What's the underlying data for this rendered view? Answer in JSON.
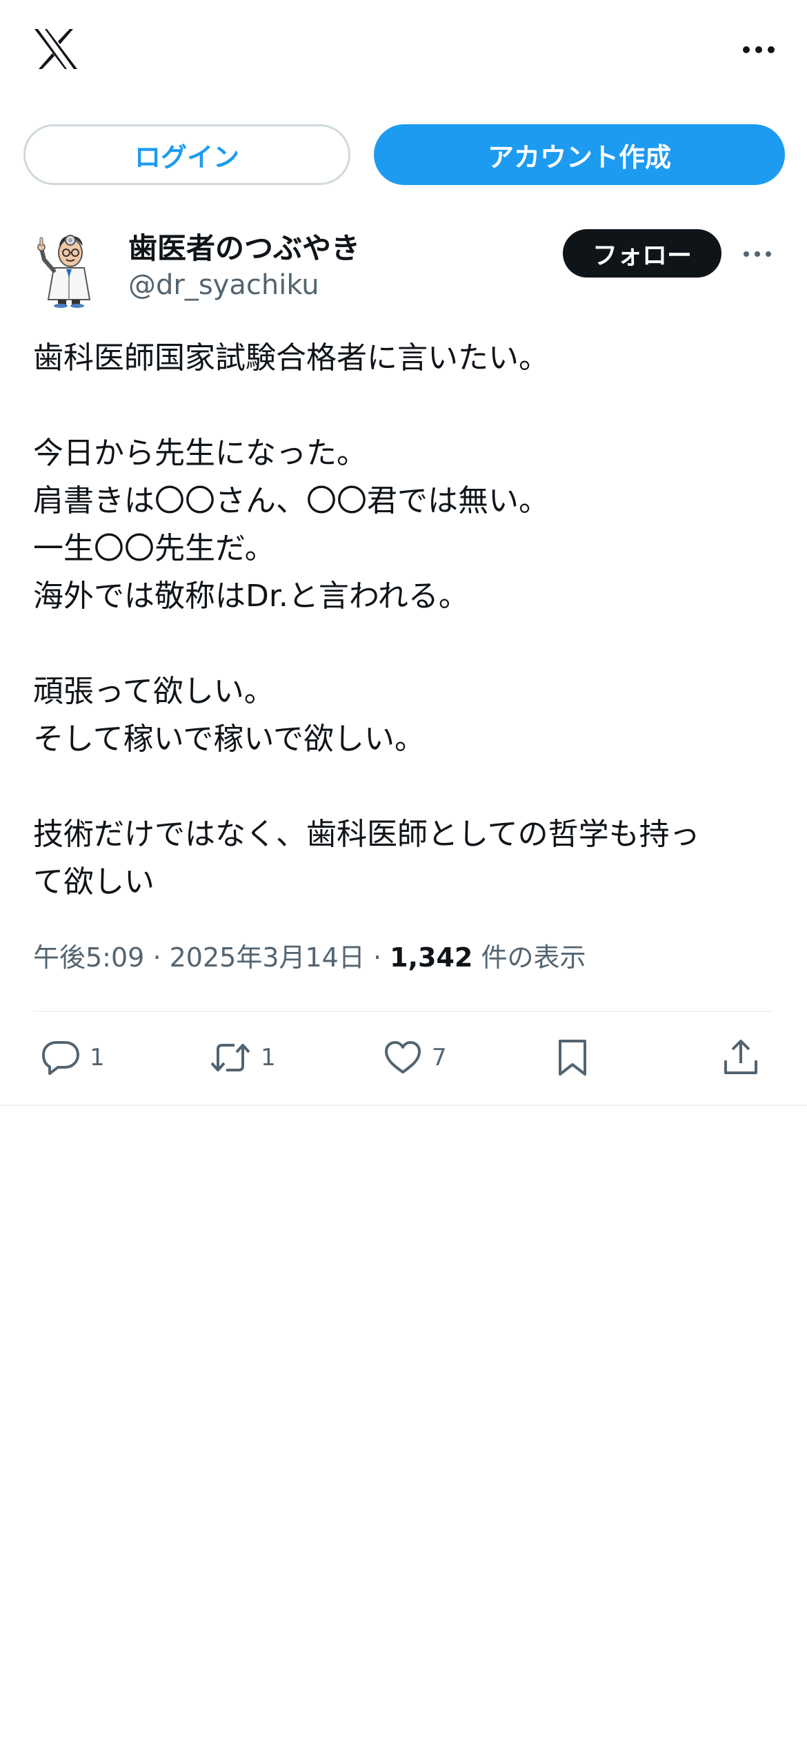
{
  "header": {
    "logo_icon": "x-logo-icon",
    "more_icon": "more-horizontal-icon"
  },
  "auth": {
    "login_label": "ログイン",
    "signup_label": "アカウント作成"
  },
  "post": {
    "author": {
      "display_name": "歯医者のつぶやき",
      "handle": "@dr_syachiku",
      "avatar_icon": "dentist-cartoon-avatar"
    },
    "follow_label": "フォロー",
    "more_icon": "more-horizontal-icon",
    "text_lines": [
      "歯科医師国家試験合格者に言いたい。",
      "",
      "今日から先生になった。",
      "肩書きは〇〇さん、〇〇君では無い。",
      "一生〇〇先生だ。",
      "海外では敬称はDr.と言われる。",
      "",
      "頑張って欲しい。",
      "そして稼いで稼いで欲しい。",
      "",
      "技術だけではなく、歯科医師としての哲学も持っ",
      "て欲しい"
    ],
    "time": "午後5:09",
    "separator": "·",
    "date": "2025年3月14日",
    "views_count": "1,342",
    "views_label": "件の表示",
    "actions": {
      "reply_count": "1",
      "repost_count": "1",
      "like_count": "7"
    }
  },
  "colors": {
    "accent": "#1d9bf0",
    "text_primary": "#0f1419",
    "text_secondary": "#536471",
    "border": "#cfd9de"
  }
}
